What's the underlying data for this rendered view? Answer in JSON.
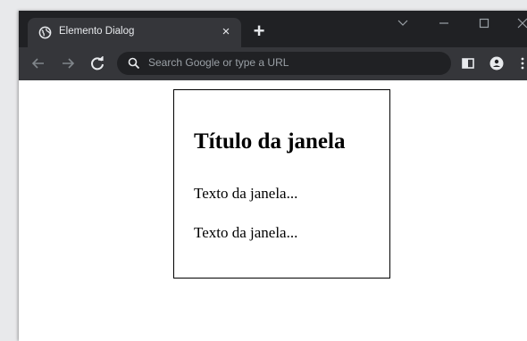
{
  "browser": {
    "tab_title": "Elemento Dialog",
    "tab_close": "×",
    "new_tab": "+",
    "omnibox_placeholder": "Search Google or type a URL"
  },
  "dialog": {
    "title": "Título da janela",
    "paragraphs": [
      "Texto da janela...",
      "Texto da janela..."
    ]
  },
  "icons": {
    "favicon": "globe-icon",
    "back": "back-arrow-icon",
    "forward": "forward-arrow-icon",
    "reload": "reload-icon",
    "search": "search-icon",
    "side_panel": "side-panel-icon",
    "profile": "profile-icon",
    "menu": "kebab-menu-icon"
  }
}
